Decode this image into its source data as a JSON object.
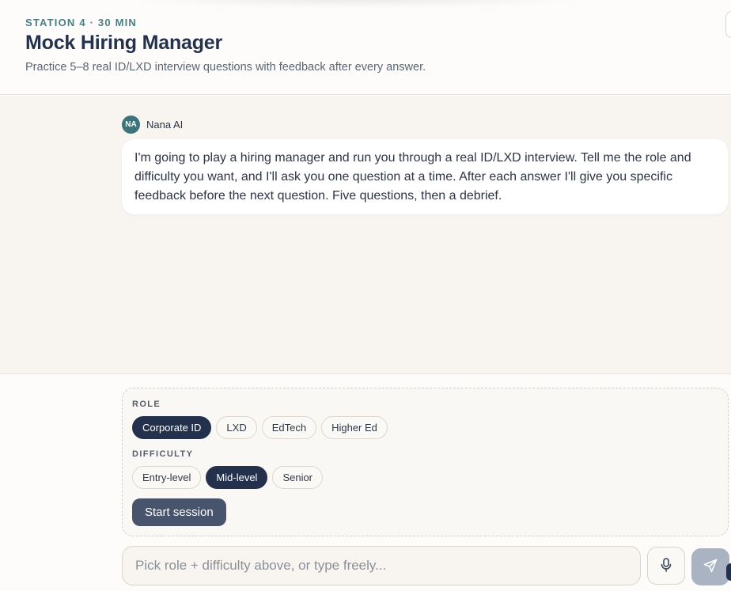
{
  "header": {
    "eyebrow": "STATION 4 · 30 MIN",
    "title": "Mock Hiring Manager",
    "subtitle": "Practice 5–8 real ID/LXD interview questions with feedback after every answer."
  },
  "chat": {
    "messages": [
      {
        "avatar_initials": "NA",
        "sender": "Nana AI",
        "text": "I'm going to play a hiring manager and run you through a real ID/LXD interview. Tell me the role and difficulty you want, and I'll ask you one question at a time. After each answer I'll give you specific feedback before the next question. Five questions, then a debrief."
      }
    ]
  },
  "setup": {
    "role_label": "ROLE",
    "roles": [
      "Corporate ID",
      "LXD",
      "EdTech",
      "Higher Ed"
    ],
    "selected_role": "Corporate ID",
    "difficulty_label": "DIFFICULTY",
    "difficulties": [
      "Entry-level",
      "Mid-level",
      "Senior"
    ],
    "selected_difficulty": "Mid-level",
    "start_label": "Start session"
  },
  "composer": {
    "placeholder": "Pick role + difficulty above, or type freely...",
    "value": "",
    "mic_icon": "microphone-icon",
    "send_icon": "send-icon"
  },
  "colors": {
    "accent_teal": "#4b7e84",
    "navy": "#24314d",
    "chip_selected": "#24314d",
    "send_disabled": "#a9b3c2"
  }
}
